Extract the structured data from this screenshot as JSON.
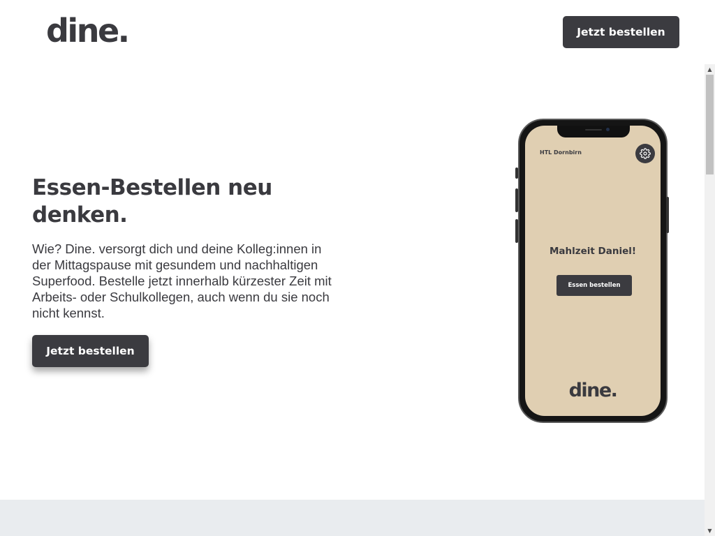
{
  "header": {
    "logo": "dine.",
    "cta_label": "Jetzt bestellen"
  },
  "hero": {
    "title": "Essen-Bestellen neu denken.",
    "text": "Wie? Dine. versorgt dich und deine Kolleg:innen in der Mittagspause mit gesundem und nachhaltigen Superfood. Bestelle jetzt innerhalb kürzester Zeit mit Arbeits- oder Schulkollegen, auch wenn du sie noch nicht kennst.",
    "cta_label": "Jetzt bestellen"
  },
  "phone": {
    "location": "HTL Dornbirn",
    "greeting": "Mahlzeit Daniel!",
    "order_button": "Essen bestellen",
    "logo": "dine.",
    "settings_icon": "gear-icon"
  },
  "scrollbar": {
    "up_icon": "▲",
    "down_icon": "▼"
  },
  "colors": {
    "primary": "#3b3b40",
    "phone_screen": "#e0cfb2",
    "section_bg": "#e9ecef"
  }
}
